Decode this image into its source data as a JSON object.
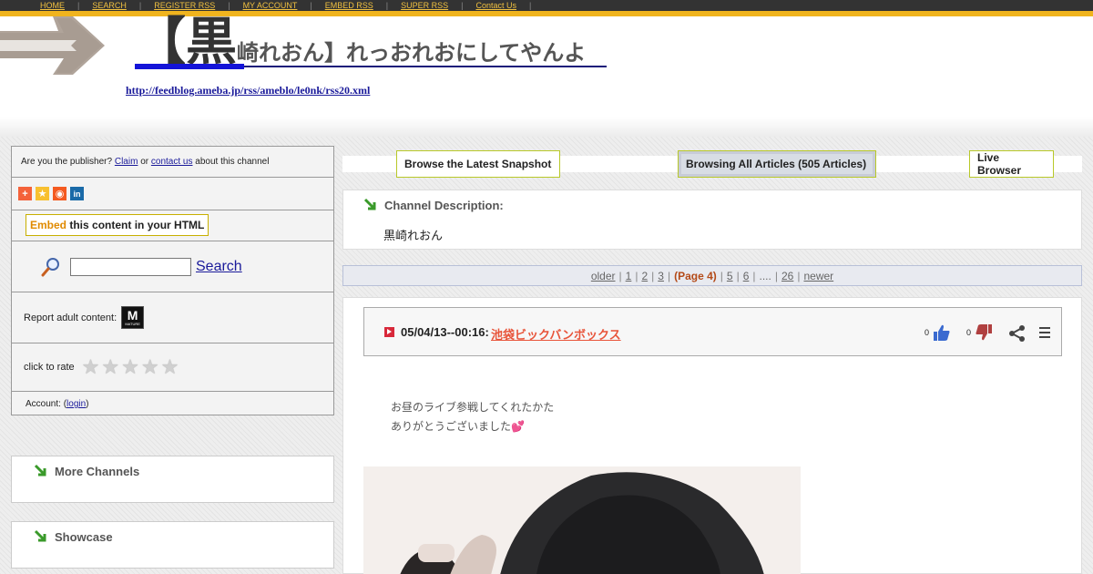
{
  "nav": {
    "items": [
      "HOME",
      "SEARCH",
      "REGISTER RSS",
      "MY ACCOUNT",
      "EMBED RSS",
      "SUPER RSS",
      "Contact Us"
    ],
    "separator": "|"
  },
  "header": {
    "title_big": "【黒",
    "title_rest": "崎れおん】れっおれおにしてやんよ",
    "feed_url": "http://feedblog.ameba.jp/rss/ameblo/le0nk/rss20.xml"
  },
  "sidebar": {
    "publisher_prefix": "Are you the publisher?",
    "claim_link": "Claim",
    "or_text": "or",
    "contact_link": "contact us",
    "publisher_suffix": "about this channel",
    "embed_highlight": "Embed",
    "embed_rest": "this content in your HTML",
    "search_link": "Search",
    "search_placeholder": "",
    "report_label": "Report adult content:",
    "mature_badge": "M",
    "mature_sub": "MATURE",
    "rate_label": "click to rate",
    "rating": 0,
    "account_prefix": "Account: (",
    "account_link": "login",
    "account_suffix": ")",
    "more_channels": "More Channels",
    "showcase": "Showcase",
    "share_icons": [
      "addthis-icon",
      "favorite-icon",
      "reddit-icon",
      "linkedin-icon"
    ],
    "share_colors": [
      "#f4623a",
      "#f8c030",
      "#f45a20",
      "#1a6aa8"
    ]
  },
  "tabs": {
    "latest": "Browse the Latest Snapshot",
    "all": "Browsing All Articles (505 Articles)",
    "live": "Live Browser"
  },
  "description": {
    "heading": "Channel Description:",
    "text": "黒崎れおん"
  },
  "pager": {
    "older": "older",
    "pages_before": [
      "1",
      "2",
      "3"
    ],
    "current": "(Page 4)",
    "pages_after": [
      "5",
      "6"
    ],
    "ellipsis": "....",
    "last": "26",
    "newer": "newer"
  },
  "article": {
    "date": "05/04/13--00:16:",
    "title": "池袋ビックバンボックス",
    "likes": "0",
    "dislikes": "0",
    "body_line1": "お昼のライブ参戦してくれたかた",
    "body_line2": "ありがとうございました",
    "heart": "💕"
  },
  "colors": {
    "nav_bg": "#333333",
    "stripe": "#f0b41e",
    "link_blue": "#1a1a9a",
    "article_title": "#e8543a",
    "current_page": "#b44a18"
  }
}
